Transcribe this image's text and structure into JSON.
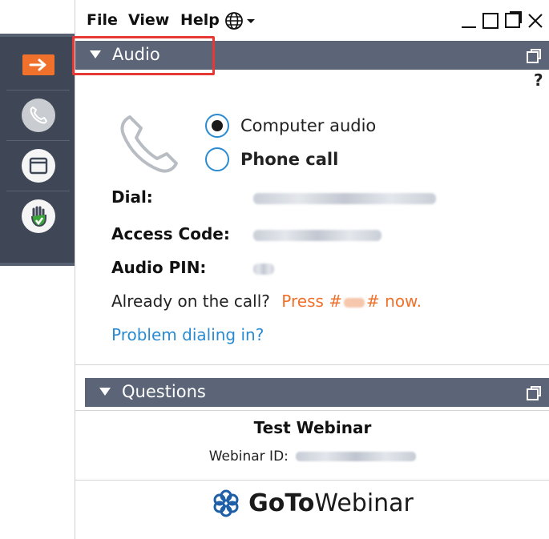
{
  "menu": {
    "file": "File",
    "view": "View",
    "help": "Help"
  },
  "toolbar": {
    "items": [
      "arrow-right-icon",
      "phone-icon",
      "window-icon",
      "raise-hand-icon"
    ],
    "accent": "#f0712b",
    "background": "#3f4756"
  },
  "audio": {
    "section_title": "Audio",
    "help_symbol": "?",
    "options": [
      {
        "label": "Computer audio",
        "selected": true
      },
      {
        "label": "Phone call",
        "selected": false
      }
    ],
    "dial_label": "Dial:",
    "access_code_label": "Access Code:",
    "audio_pin_label": "Audio PIN:",
    "already_on_call": "Already on the call?",
    "press_prefix": "Press #",
    "press_suffix": "# now.",
    "problem_link": "Problem dialing in?"
  },
  "questions": {
    "section_title": "Questions"
  },
  "webinar": {
    "title": "Test Webinar",
    "id_label": "Webinar ID:"
  },
  "brand": {
    "goto": "GoTo",
    "webinar": "Webinar",
    "bar_color": "#5b6577",
    "link_color": "#2a8bd1",
    "highlight_color": "#e53935"
  }
}
